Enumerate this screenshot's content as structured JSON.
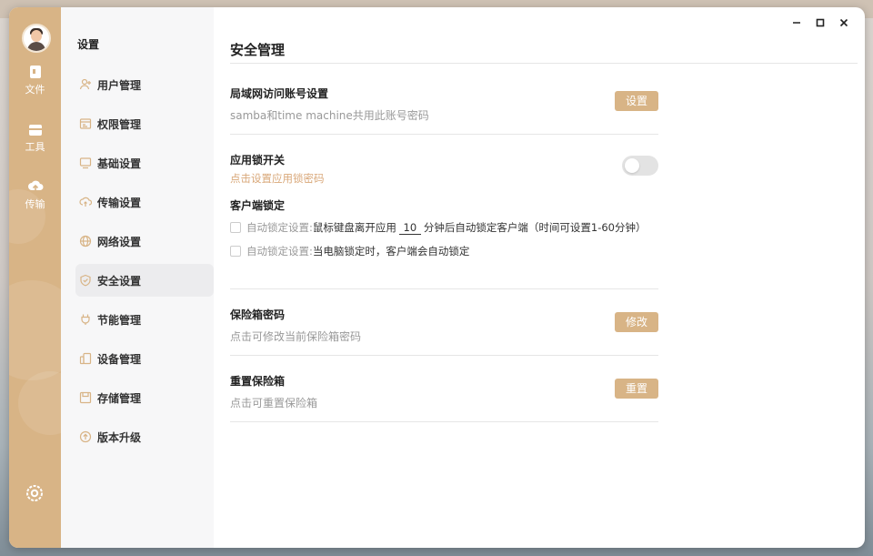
{
  "sidebar": {
    "title": "设置",
    "items": [
      {
        "label": "用户管理",
        "icon": "user-add-icon"
      },
      {
        "label": "权限管理",
        "icon": "permission-icon"
      },
      {
        "label": "基础设置",
        "icon": "monitor-icon"
      },
      {
        "label": "传输设置",
        "icon": "cloud-transfer-icon"
      },
      {
        "label": "网络设置",
        "icon": "globe-icon"
      },
      {
        "label": "安全设置",
        "icon": "shield-icon",
        "active": true
      },
      {
        "label": "节能管理",
        "icon": "plug-icon"
      },
      {
        "label": "设备管理",
        "icon": "device-icon"
      },
      {
        "label": "存储管理",
        "icon": "storage-icon"
      },
      {
        "label": "版本升级",
        "icon": "upgrade-icon"
      }
    ]
  },
  "rail": {
    "items": [
      {
        "label": "文件",
        "icon": "file-icon"
      },
      {
        "label": "工具",
        "icon": "toolbox-icon"
      },
      {
        "label": "传输",
        "icon": "cloud-upload-icon"
      }
    ]
  },
  "main": {
    "title": "安全管理",
    "lan_account": {
      "title": "局域网访问账号设置",
      "desc": "samba和time machine共用此账号密码",
      "button": "设置"
    },
    "app_lock": {
      "title": "应用锁开关",
      "desc": "点击设置应用锁密码",
      "enabled": false
    },
    "client_lock": {
      "title": "客户端锁定",
      "option1": {
        "prefix": "自动锁定设置:",
        "text_before": "鼠标键盘离开应用",
        "minutes": "10",
        "text_after": "分钟后自动锁定客户端（时间可设置1-60分钟）",
        "checked": false
      },
      "option2": {
        "prefix": "自动锁定设置:",
        "text": "当电脑锁定时，客户端会自动锁定",
        "checked": false
      }
    },
    "vault_password": {
      "title": "保险箱密码",
      "desc": "点击可修改当前保险箱密码",
      "button": "修改"
    },
    "vault_reset": {
      "title": "重置保险箱",
      "desc": "点击可重置保险箱",
      "button": "重置"
    }
  },
  "colors": {
    "accent": "#d8b486",
    "accent_text": "#d9a87a",
    "sidebar_bg": "#f7f7f8",
    "active_bg": "#ececee"
  }
}
